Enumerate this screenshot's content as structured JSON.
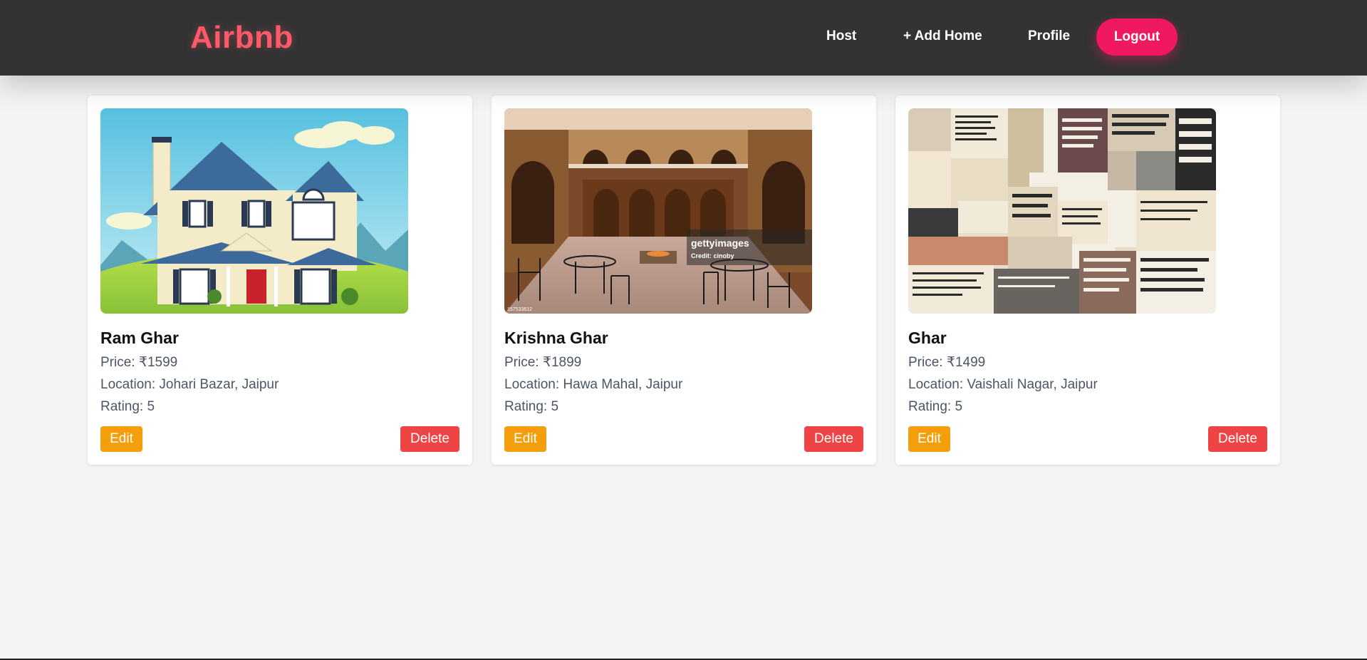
{
  "navbar": {
    "brand": "Airbnb",
    "links": [
      "Host",
      "+ Add Home",
      "Profile"
    ],
    "logout_label": "Logout"
  },
  "labels": {
    "price": "Price: ",
    "location": "Location: ",
    "rating": "Rating: ",
    "edit": "Edit",
    "delete": "Delete"
  },
  "homes": [
    {
      "name": "Ram Ghar",
      "price": "₹1599",
      "location": "Johari Bazar, Jaipur",
      "rating": "5",
      "image": "house-illustration"
    },
    {
      "name": "Krishna Ghar",
      "price": "₹1899",
      "location": "Hawa Mahal, Jaipur",
      "rating": "5",
      "image": "haveli-courtyard-photo",
      "image_watermark": "gettyimages",
      "image_credit": "Credit: cinoby",
      "image_id": "157533612"
    },
    {
      "name": "Ghar",
      "price": "₹1499",
      "location": "Vaishali Nagar, Jaipur",
      "rating": "5",
      "image": "quotes-collage"
    }
  ],
  "colors": {
    "navbar_bg": "#333333",
    "brand": "#ff5a6a",
    "logout": "#f0185f",
    "edit": "#f59e0b",
    "delete": "#ef4444",
    "page_bg": "#f3f4f6"
  }
}
